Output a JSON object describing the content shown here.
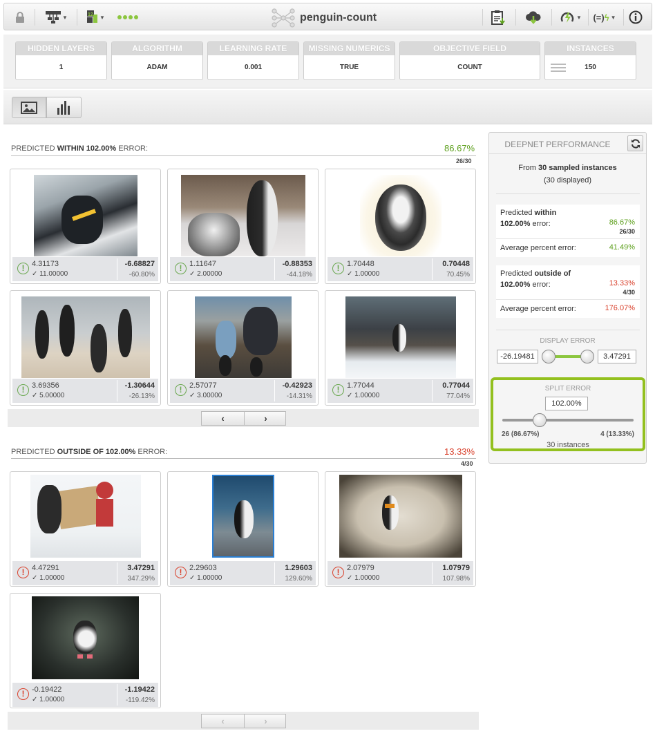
{
  "toolbar": {
    "title": "penguin-count",
    "left_icons": [
      "lock-icon",
      "tree-icon",
      "dataset-icon",
      "status-dots-icon"
    ],
    "right_icons": [
      "clipboard-download-icon",
      "cloud-download-icon",
      "power-icon",
      "formula-icon",
      "info-icon"
    ]
  },
  "params": [
    {
      "label": "HIDDEN LAYERS",
      "value": "1"
    },
    {
      "label": "ALGORITHM",
      "value": "ADAM"
    },
    {
      "label": "LEARNING RATE",
      "value": "0.001"
    },
    {
      "label": "MISSING NUMERICS",
      "value": "TRUE"
    },
    {
      "label": "OBJECTIVE FIELD",
      "value": "COUNT"
    },
    {
      "label": "INSTANCES",
      "value": "150"
    }
  ],
  "within": {
    "prefix": "PREDICTED ",
    "bold": "WITHIN 102.00%",
    "suffix": " ERROR:",
    "percent": "86.67%",
    "count": "26/30",
    "cards": [
      {
        "predicted": "4.31173",
        "actual": "11.00000",
        "diff": "-6.68827",
        "pct": "-60.80%"
      },
      {
        "predicted": "1.11647",
        "actual": "2.00000",
        "diff": "-0.88353",
        "pct": "-44.18%"
      },
      {
        "predicted": "1.70448",
        "actual": "1.00000",
        "diff": "0.70448",
        "pct": "70.45%"
      },
      {
        "predicted": "3.69356",
        "actual": "5.00000",
        "diff": "-1.30644",
        "pct": "-26.13%"
      },
      {
        "predicted": "2.57077",
        "actual": "3.00000",
        "diff": "-0.42923",
        "pct": "-14.31%"
      },
      {
        "predicted": "1.77044",
        "actual": "1.00000",
        "diff": "0.77044",
        "pct": "77.04%"
      }
    ]
  },
  "outside": {
    "prefix": "PREDICTED ",
    "bold": "OUTSIDE OF 102.00%",
    "suffix": " ERROR:",
    "percent": "13.33%",
    "count": "4/30",
    "cards": [
      {
        "predicted": "4.47291",
        "actual": "1.00000",
        "diff": "3.47291",
        "pct": "347.29%"
      },
      {
        "predicted": "2.29603",
        "actual": "1.00000",
        "diff": "1.29603",
        "pct": "129.60%"
      },
      {
        "predicted": "2.07979",
        "actual": "1.00000",
        "diff": "1.07979",
        "pct": "107.98%"
      },
      {
        "predicted": "-0.19422",
        "actual": "1.00000",
        "diff": "-1.19422",
        "pct": "-119.42%"
      }
    ]
  },
  "pager": {
    "prev": "‹",
    "next": "›"
  },
  "panel": {
    "title": "DEEPNET PERFORMANCE",
    "from_prefix": "From ",
    "from_bold": "30 sampled instances",
    "displayed": "(30 displayed)",
    "within_label_1": "Predicted ",
    "within_label_bold": "within",
    "within_label_2_bold": "102.00%",
    "within_label_2": " error:",
    "within_pct": "86.67%",
    "within_count": "26/30",
    "within_avg_label": "Average percent error:",
    "within_avg": "41.49%",
    "outside_label_1": "Predicted ",
    "outside_label_bold": "outside of",
    "outside_label_2_bold": "102.00%",
    "outside_label_2": " error:",
    "outside_pct": "13.33%",
    "outside_count": "4/30",
    "outside_avg_label": "Average percent error:",
    "outside_avg": "176.07%",
    "display_error_label": "DISPLAY ERROR",
    "display_min": "-26.19481",
    "display_max": "3.47291",
    "split_label": "SPLIT ERROR",
    "split_value": "102.00%",
    "split_left": "26 (86.67%)",
    "split_right": "4 (13.33%)",
    "split_total": "30 instances"
  },
  "colors": {
    "accent_green": "#93c01f",
    "good": "#5ea01e",
    "bad": "#d9412c"
  }
}
